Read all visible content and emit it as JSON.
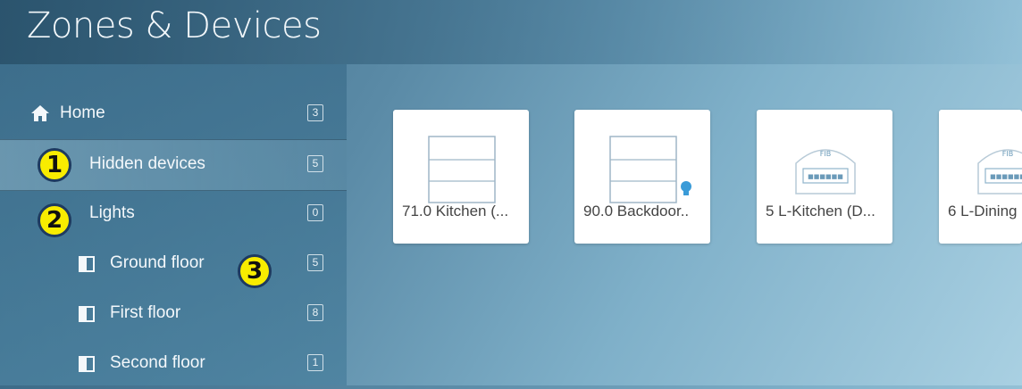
{
  "header": {
    "title": "Zones & Devices"
  },
  "sidebar": {
    "items": [
      {
        "label": "Home",
        "count": "3"
      },
      {
        "label": "Hidden devices",
        "count": "5"
      },
      {
        "label": "Lights",
        "count": "0"
      },
      {
        "label": "Ground floor",
        "count": "5"
      },
      {
        "label": "First floor",
        "count": "8"
      },
      {
        "label": "Second floor",
        "count": "1"
      }
    ]
  },
  "annotations": {
    "badge1": "1",
    "badge2": "2",
    "badge3": "3"
  },
  "devices": [
    {
      "label": "71.0 Kitchen (..."
    },
    {
      "label": "90.0 Backdoor.."
    },
    {
      "label": "5 L-Kitchen (D..."
    },
    {
      "label": "6 L-Dining"
    }
  ],
  "colors": {
    "badge": "#f8ec00",
    "badge_border": "#1e3a5f",
    "bulb": "#3a9bd8"
  }
}
